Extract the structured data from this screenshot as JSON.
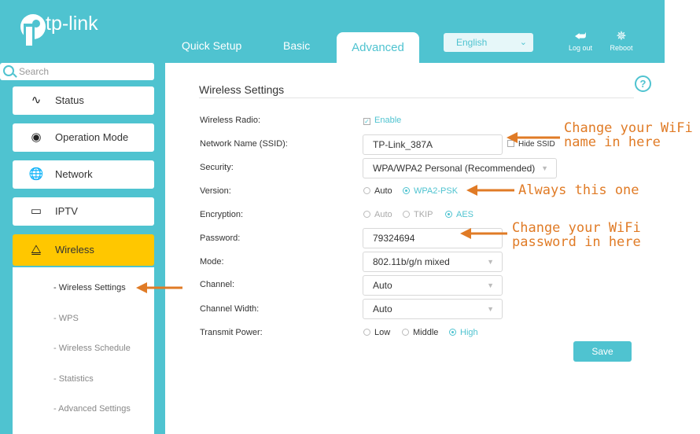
{
  "brand": {
    "name": "tp-link",
    "color": "#4fc3d0",
    "active_color": "#ffc700"
  },
  "topnav": {
    "tabs": [
      "Quick Setup",
      "Basic",
      "Advanced"
    ],
    "active_tab": "Advanced",
    "language": "English",
    "logout_label": "Log out",
    "reboot_label": "Reboot"
  },
  "sidebar": {
    "search_placeholder": "Search",
    "items": [
      {
        "label": "Status",
        "icon": "pulse-icon"
      },
      {
        "label": "Operation Mode",
        "icon": "toggle-icon"
      },
      {
        "label": "Network",
        "icon": "globe-icon"
      },
      {
        "label": "IPTV",
        "icon": "monitor-icon"
      },
      {
        "label": "Wireless",
        "icon": "wifi-icon",
        "active": true
      }
    ],
    "submenu": [
      "- Wireless Settings",
      "- WPS",
      "- Wireless Schedule",
      "- Statistics",
      "- Advanced Settings"
    ],
    "current_submenu": "- Wireless Settings"
  },
  "main": {
    "title": "Wireless Settings",
    "fields": {
      "wireless_radio": {
        "label": "Wireless Radio:",
        "value": "Enable",
        "checked": true
      },
      "ssid": {
        "label": "Network Name (SSID):",
        "value": "TP-Link_387A",
        "hide_label": "Hide SSID"
      },
      "security": {
        "label": "Security:",
        "value": "WPA/WPA2 Personal (Recommended)"
      },
      "version": {
        "label": "Version:",
        "options": [
          "Auto",
          "WPA2-PSK"
        ],
        "selected": "WPA2-PSK"
      },
      "encryption": {
        "label": "Encryption:",
        "options": [
          "Auto",
          "TKIP",
          "AES"
        ],
        "selected": "AES"
      },
      "password": {
        "label": "Password:",
        "value": "79324694"
      },
      "mode": {
        "label": "Mode:",
        "value": "802.11b/g/n mixed"
      },
      "channel": {
        "label": "Channel:",
        "value": "Auto"
      },
      "channel_width": {
        "label": "Channel Width:",
        "value": "Auto"
      },
      "transmit_power": {
        "label": "Transmit Power:",
        "options": [
          "Low",
          "Middle",
          "High"
        ],
        "selected": "High"
      }
    },
    "save_label": "Save"
  },
  "annotations": {
    "color": "#e07b26",
    "ssid_note": "Change your WiFi\nname in here",
    "version_note": "Always this one",
    "password_note": "Change your WiFi\npassword in here"
  }
}
